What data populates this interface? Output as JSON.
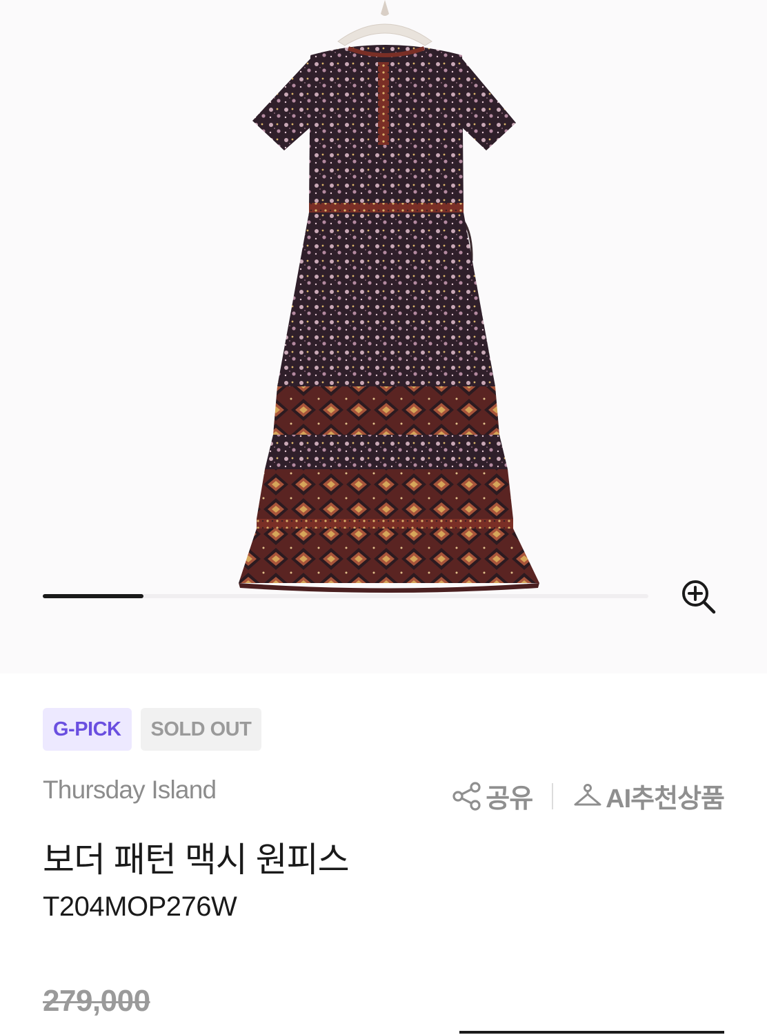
{
  "gallery": {
    "slide_progress": 0.166,
    "zoom_icon": "zoom-in-icon",
    "image_subject": "floral-border-pattern-dress"
  },
  "badges": {
    "gpick": "G-PICK",
    "soldout": "SOLD OUT"
  },
  "brand": "Thursday Island",
  "actions": {
    "share_label": "공유",
    "share_icon": "share-icon",
    "ai_label": "AI추천상품",
    "ai_icon": "hanger-icon"
  },
  "product": {
    "title": "보더 패턴 맥시 원피스",
    "code": "T204MOP276W"
  },
  "price": {
    "original": "279,000"
  },
  "colors": {
    "accent_purple": "#6a4fe0",
    "badge_purple_bg": "#ede9ff",
    "gray_text": "#8f8f8f"
  }
}
